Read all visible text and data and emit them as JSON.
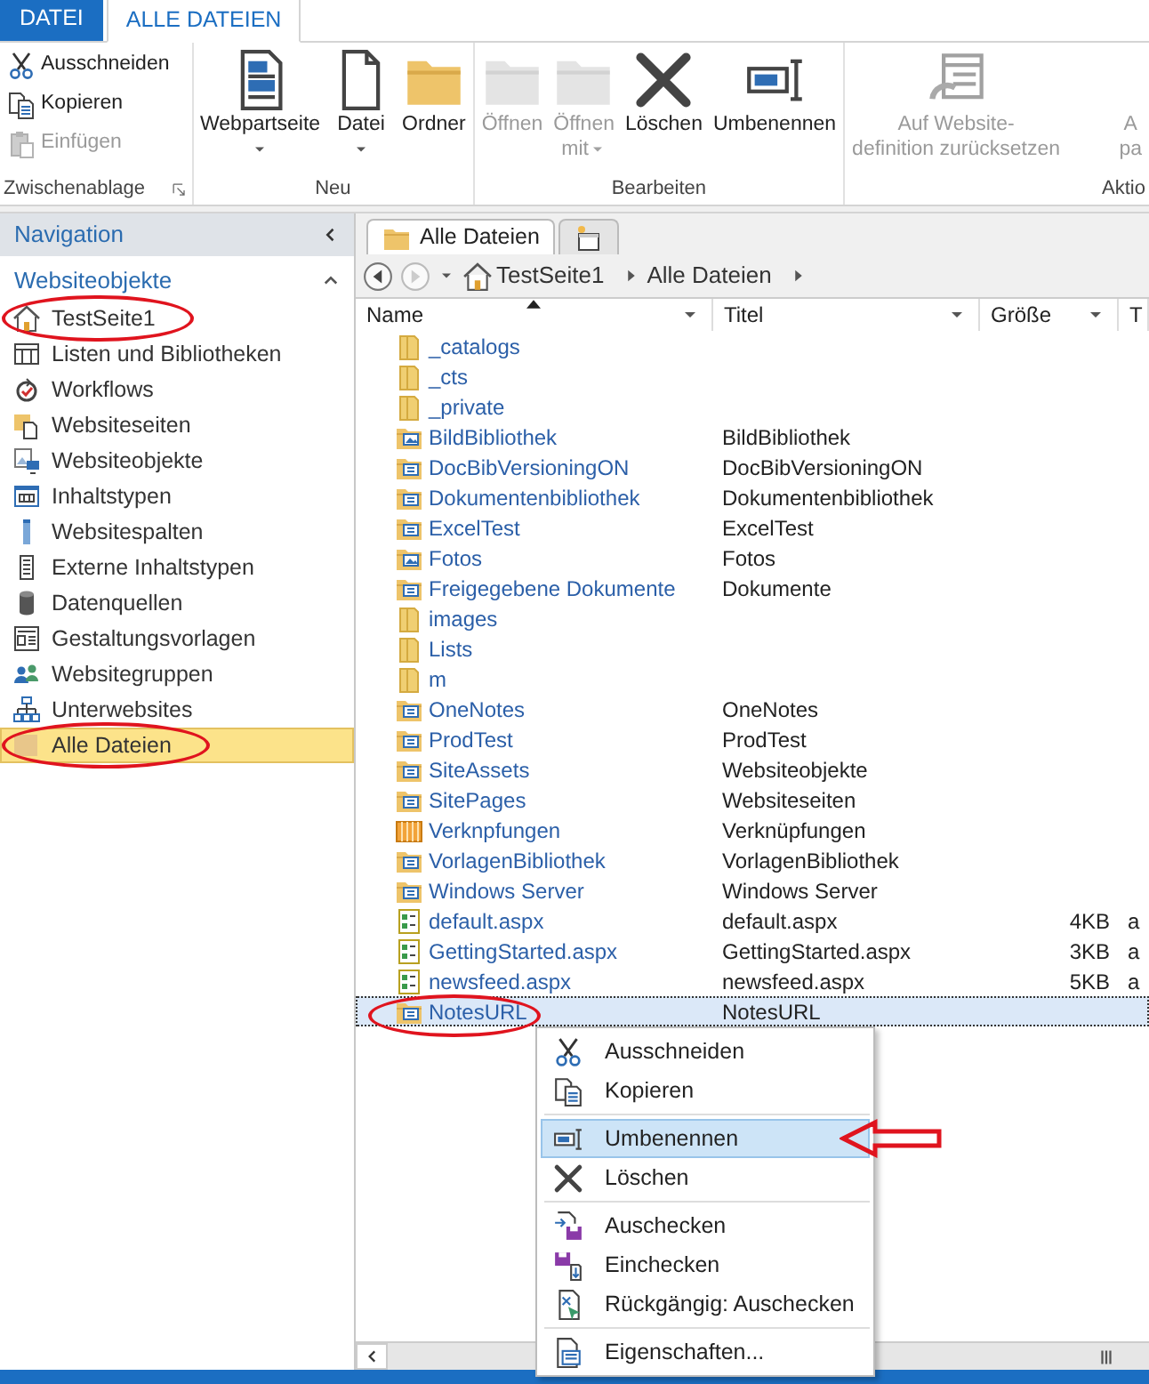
{
  "ribbon": {
    "tabs": [
      {
        "label": "DATEI",
        "kind": "backstage",
        "selected": false
      },
      {
        "label": "ALLE DATEIEN",
        "kind": "tab",
        "selected": true
      }
    ],
    "groups": [
      {
        "label": "Zwischenablage",
        "kind": "stack",
        "launcher": true,
        "buttons": [
          {
            "lines": [
              "Ausschneiden"
            ],
            "kind": "cut",
            "disabled": false
          },
          {
            "lines": [
              "Kopieren"
            ],
            "kind": "copy",
            "disabled": false
          },
          {
            "lines": [
              "Einfügen"
            ],
            "kind": "paste",
            "disabled": true
          }
        ]
      },
      {
        "label": "Neu",
        "kind": "row",
        "buttons": [
          {
            "lines": [
              "Webpartseite"
            ],
            "kind": "webpart",
            "dropdown": true,
            "disabled": false
          },
          {
            "lines": [
              "Datei"
            ],
            "kind": "file",
            "dropdown": true,
            "disabled": false
          },
          {
            "lines": [
              "Ordner"
            ],
            "kind": "folder",
            "disabled": false
          }
        ]
      },
      {
        "label": "Bearbeiten",
        "kind": "row",
        "buttons": [
          {
            "lines": [
              "Öffnen"
            ],
            "kind": "open",
            "disabled": true
          },
          {
            "lines": [
              "Öffnen",
              "mit"
            ],
            "kind": "open-with",
            "dropdown": true,
            "disabled": true
          },
          {
            "lines": [
              "Löschen"
            ],
            "kind": "delete",
            "disabled": false
          },
          {
            "lines": [
              "Umbenennen"
            ],
            "kind": "rename",
            "disabled": false
          }
        ]
      },
      {
        "label": "Aktio",
        "kind": "row",
        "buttons": [
          {
            "lines": [
              "Auf Website-",
              "definition zurücksetzen"
            ],
            "kind": "reset",
            "disabled": true
          },
          {
            "lines": [
              "A",
              "pa"
            ],
            "kind": "cut-off",
            "disabled": true
          }
        ]
      }
    ]
  },
  "nav": {
    "title": "Navigation",
    "section": {
      "label": "Websiteobjekte",
      "expanded": true
    },
    "items": [
      {
        "label": "TestSeite1",
        "kind": "home",
        "selected": false,
        "circled": true
      },
      {
        "label": "Listen und Bibliotheken",
        "kind": "lists",
        "selected": false,
        "circled": false
      },
      {
        "label": "Workflows",
        "kind": "workflows",
        "selected": false,
        "circled": false
      },
      {
        "label": "Websiteseiten",
        "kind": "pages",
        "selected": false,
        "circled": false
      },
      {
        "label": "Websiteobjekte",
        "kind": "assets",
        "selected": false,
        "circled": false
      },
      {
        "label": "Inhaltstypen",
        "kind": "content-types",
        "selected": false,
        "circled": false
      },
      {
        "label": "Websitespalten",
        "kind": "columns",
        "selected": false,
        "circled": false
      },
      {
        "label": "Externe Inhaltstypen",
        "kind": "external-types",
        "selected": false,
        "circled": false
      },
      {
        "label": "Datenquellen",
        "kind": "data-sources",
        "selected": false,
        "circled": false
      },
      {
        "label": "Gestaltungsvorlagen",
        "kind": "master-pages",
        "selected": false,
        "circled": false
      },
      {
        "label": "Websitegruppen",
        "kind": "groups",
        "selected": false,
        "circled": false
      },
      {
        "label": "Unterwebsites",
        "kind": "subsites",
        "selected": false,
        "circled": false
      },
      {
        "label": "Alle Dateien",
        "kind": "all-files",
        "selected": true,
        "circled": true
      }
    ]
  },
  "doc_tabs": [
    {
      "label": "Alle Dateien",
      "kind": "folder",
      "selected": true
    },
    {
      "kind": "new",
      "selected": false
    }
  ],
  "breadcrumb": {
    "back_enabled": true,
    "forward_enabled": false,
    "items": [
      "TestSeite1",
      "Alle Dateien"
    ]
  },
  "table": {
    "columns": [
      {
        "label": "Name",
        "sorted": true
      },
      {
        "label": "Titel",
        "sorted": false
      },
      {
        "label": "Größe",
        "sorted": false
      },
      {
        "label": "T",
        "sorted": false
      }
    ],
    "rows": [
      {
        "name": "_catalogs",
        "kind": "folder",
        "selected": false,
        "circled": false
      },
      {
        "name": "_cts",
        "kind": "folder",
        "selected": false,
        "circled": false
      },
      {
        "name": "_private",
        "kind": "folder",
        "selected": false,
        "circled": false
      },
      {
        "name": "BildBibliothek",
        "title": "BildBibliothek",
        "kind": "piclib",
        "selected": false,
        "circled": false
      },
      {
        "name": "DocBibVersioningON",
        "title": "DocBibVersioningON",
        "kind": "lib",
        "selected": false,
        "circled": false
      },
      {
        "name": "Dokumentenbibliothek",
        "title": "Dokumentenbibliothek",
        "kind": "lib",
        "selected": false,
        "circled": false
      },
      {
        "name": "ExcelTest",
        "title": "ExcelTest",
        "kind": "lib",
        "selected": false,
        "circled": false
      },
      {
        "name": "Fotos",
        "title": "Fotos",
        "kind": "piclib",
        "selected": false,
        "circled": false
      },
      {
        "name": "Freigegebene Dokumente",
        "title": "Dokumente",
        "kind": "lib",
        "selected": false,
        "circled": false
      },
      {
        "name": "images",
        "kind": "folder",
        "selected": false,
        "circled": false
      },
      {
        "name": "Lists",
        "kind": "folder",
        "selected": false,
        "circled": false
      },
      {
        "name": "m",
        "kind": "folder",
        "selected": false,
        "circled": false
      },
      {
        "name": "OneNotes",
        "title": "OneNotes",
        "kind": "lib",
        "selected": false,
        "circled": false
      },
      {
        "name": "ProdTest",
        "title": "ProdTest",
        "kind": "lib",
        "selected": false,
        "circled": false
      },
      {
        "name": "SiteAssets",
        "title": "Websiteobjekte",
        "kind": "lib",
        "selected": false,
        "circled": false
      },
      {
        "name": "SitePages",
        "title": "Websiteseiten",
        "kind": "lib",
        "selected": false,
        "circled": false
      },
      {
        "name": "Verknpfungen",
        "title": "Verknüpfungen",
        "kind": "list",
        "selected": false,
        "circled": false
      },
      {
        "name": "VorlagenBibliothek",
        "title": "VorlagenBibliothek",
        "kind": "lib",
        "selected": false,
        "circled": false
      },
      {
        "name": "Windows Server",
        "title": "Windows Server",
        "kind": "lib",
        "selected": false,
        "circled": false
      },
      {
        "name": "default.aspx",
        "title": "default.aspx",
        "size": "4KB",
        "type": "a",
        "kind": "page",
        "selected": false,
        "circled": false
      },
      {
        "name": "GettingStarted.aspx",
        "title": "GettingStarted.aspx",
        "size": "3KB",
        "type": "a",
        "kind": "page",
        "selected": false,
        "circled": false
      },
      {
        "name": "newsfeed.aspx",
        "title": "newsfeed.aspx",
        "size": "5KB",
        "type": "a",
        "kind": "page",
        "selected": false,
        "circled": false
      },
      {
        "name": "NotesURL",
        "title": "NotesURL",
        "kind": "lib",
        "selected": true,
        "circled": true
      }
    ]
  },
  "context_menu": [
    {
      "kind": "cut",
      "label": "Ausschneiden",
      "selected": false,
      "arrow": false
    },
    {
      "kind": "copy",
      "label": "Kopieren",
      "selected": false,
      "arrow": false
    },
    {
      "kind": "separator"
    },
    {
      "kind": "rename",
      "label": "Umbenennen",
      "selected": true,
      "arrow": true
    },
    {
      "kind": "delete",
      "label": "Löschen",
      "selected": false,
      "arrow": false
    },
    {
      "kind": "separator"
    },
    {
      "kind": "check-out",
      "label": "Auschecken",
      "selected": false,
      "arrow": false
    },
    {
      "kind": "check-in",
      "label": "Einchecken",
      "selected": false,
      "arrow": false
    },
    {
      "kind": "undo-check-out",
      "label": "Rückgängig: Auschecken",
      "selected": false,
      "arrow": false
    },
    {
      "kind": "separator"
    },
    {
      "kind": "properties",
      "label": "Eigenschaften...",
      "selected": false,
      "arrow": false
    }
  ]
}
